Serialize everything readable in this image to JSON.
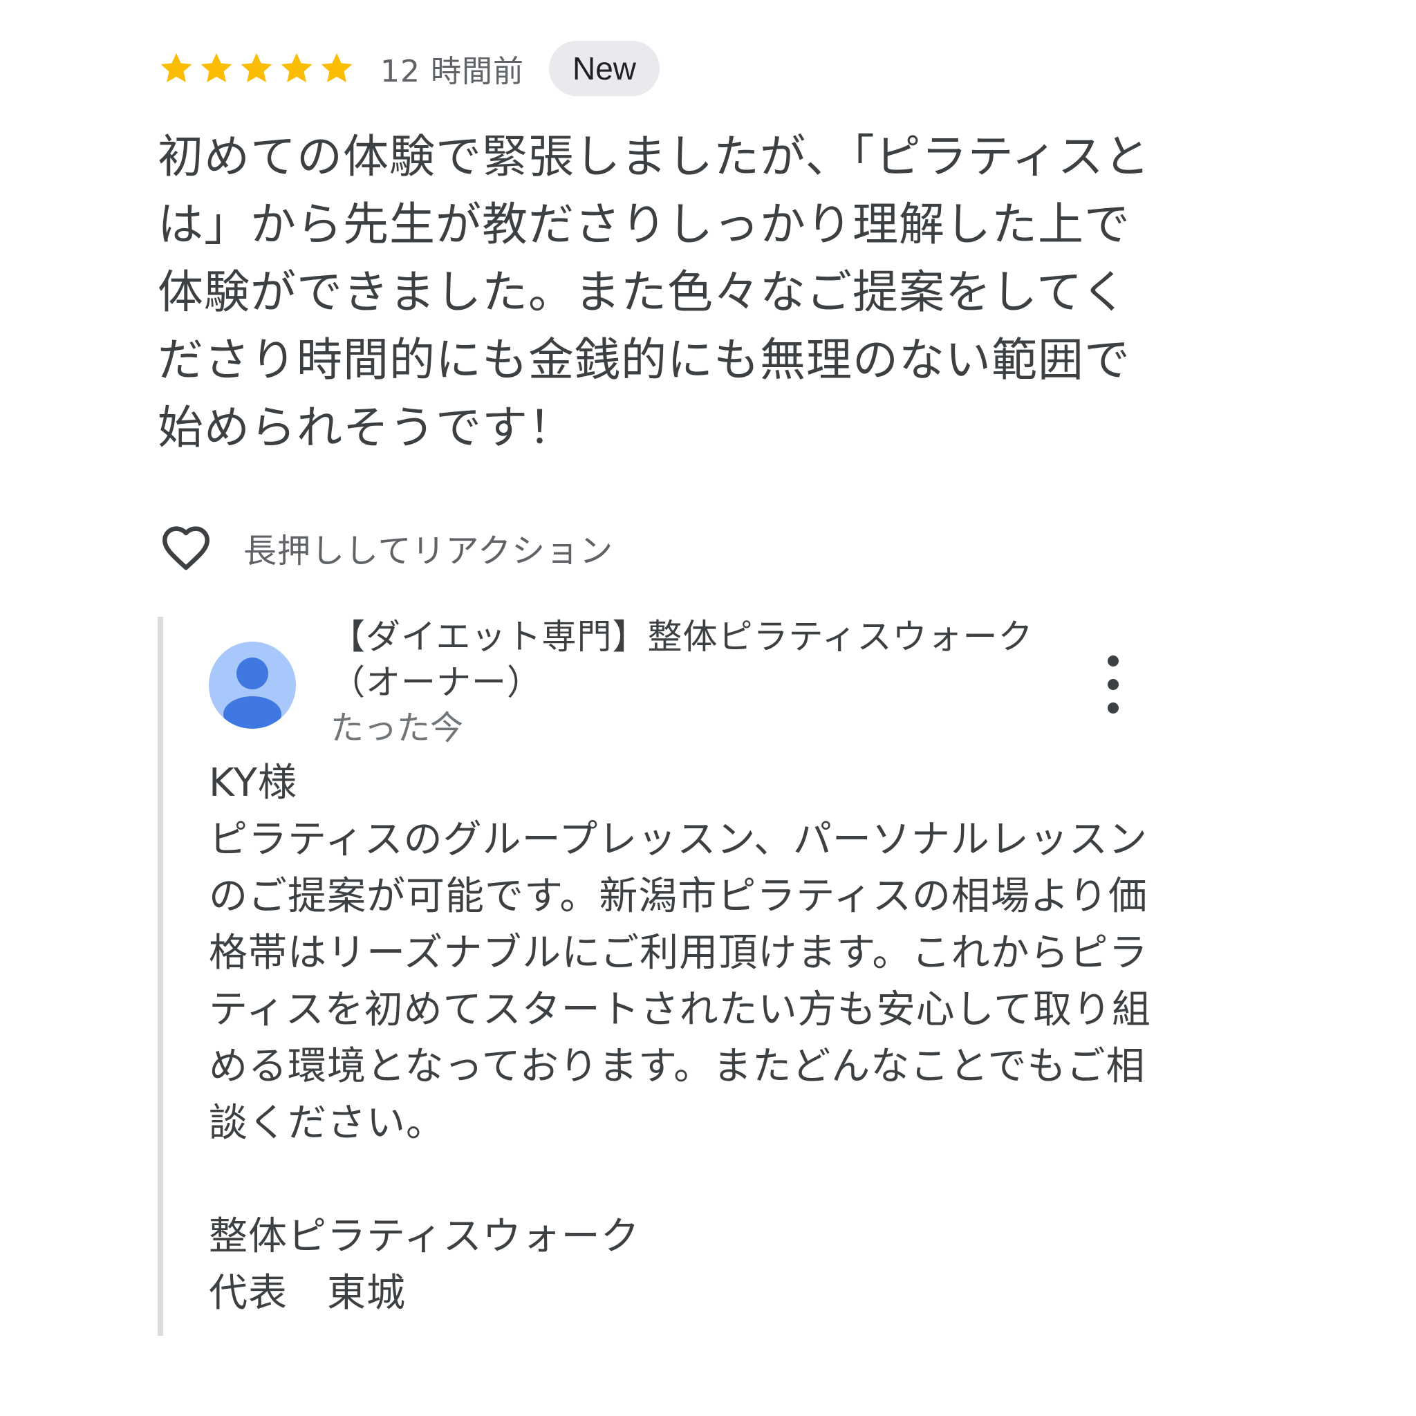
{
  "review": {
    "rating": 5,
    "rating_max": 5,
    "star_color": "#fbbc04",
    "time_ago": "12 時間前",
    "badge": "New",
    "text": "初めての体験で緊張しましたが、「ピラティスとは」から先生が教ださりしっかり理解した上で体験ができました。また色々なご提案をしてくださり時間的にも金銭的にも無理のない範囲で始められそうです！"
  },
  "reaction": {
    "icon": "heart-outline-icon",
    "label": "長押ししてリアクション"
  },
  "owner_reply": {
    "avatar_icon": "person-avatar-icon",
    "avatar_bg": "#a8c7fa",
    "avatar_fg": "#3f78e0",
    "name": "【ダイエット専門】整体ピラティスウォーク（オーナー）",
    "time": "たった今",
    "menu_icon": "more-vert-icon",
    "text": "KY様\nピラティスのグループレッスン、パーソナルレッスンのご提案が可能です。新潟市ピラティスの相場より価格帯はリーズナブルにご利用頂けます。これからピラティスを初めてスタートされたい方も安心して取り組める環境となっております。またどんなことでもご相談ください。\n\n整体ピラティスウォーク\n代表　東城"
  }
}
